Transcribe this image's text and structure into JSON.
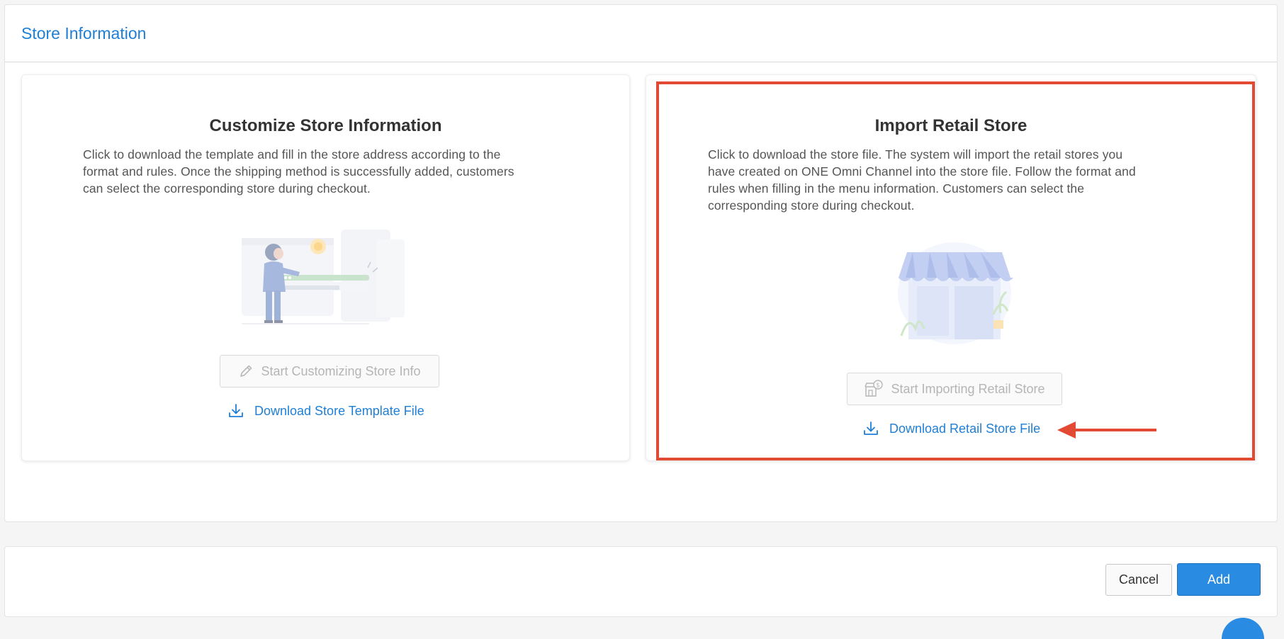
{
  "header": {
    "title": "Store Information"
  },
  "cards": {
    "customize": {
      "title": "Customize Store Information",
      "description_lines": [
        "Click to download the template and fill in the store address according to the",
        "format and rules. Once the shipping method is successfully added, customers",
        "can select the corresponding store during checkout."
      ],
      "button_label": "Start Customizing Store Info",
      "button_icon": "pencil-icon",
      "download_label": "Download Store Template File",
      "download_icon": "download-icon"
    },
    "import": {
      "title": "Import Retail Store",
      "description_lines": [
        "Click to download the store file. The system will import the retail stores you",
        "have created on ONE Omni Channel into the store file. Follow the format and",
        "rules when filling in the menu information. Customers can select the",
        "corresponding store during checkout."
      ],
      "button_label": "Start Importing Retail Store",
      "button_icon": "store-dollar-icon",
      "download_label": "Download Retail Store File",
      "download_icon": "download-icon"
    }
  },
  "footer": {
    "cancel_label": "Cancel",
    "add_label": "Add"
  },
  "colors": {
    "accent": "#1f7fd6",
    "primary_button": "#2a8be3",
    "highlight": "#e34a33",
    "disabled_text": "#b5b5b5"
  }
}
